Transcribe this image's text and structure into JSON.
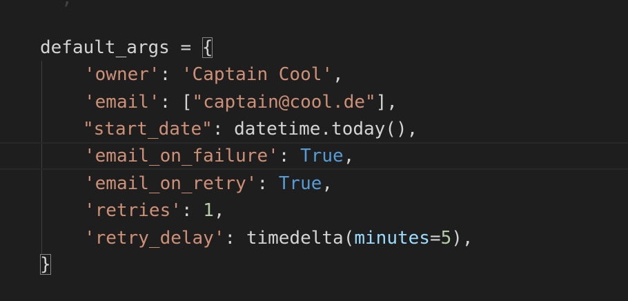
{
  "colors": {
    "background": "#1e1e1e",
    "string": "#ce9178",
    "keyword": "#569cd6",
    "number": "#b5cea8",
    "parameter": "#9cdcfe",
    "text": "#d4d4d4"
  },
  "code": {
    "partial_top": "  , ",
    "line_assign": {
      "name": "default_args",
      "op": " = ",
      "open": "{"
    },
    "line_owner": {
      "key": "'owner'",
      "sep": ": ",
      "value": "'Captain Cool'",
      "end": ","
    },
    "line_email": {
      "key": "'email'",
      "sep": ": ",
      "open": "[",
      "value": "\"captain@cool.de\"",
      "close": "],"
    },
    "line_start_date": {
      "key": "\"start_date\"",
      "sep": ": ",
      "value": "datetime.today()",
      "end": ","
    },
    "line_email_on_failure": {
      "key": "'email_on_failure'",
      "sep": ": ",
      "value": "True",
      "end": ","
    },
    "line_email_on_retry": {
      "key": "'email_on_retry'",
      "sep": ": ",
      "value": "True",
      "end": ","
    },
    "line_retries": {
      "key": "'retries'",
      "sep": ": ",
      "value": "1",
      "end": ","
    },
    "line_retry_delay": {
      "key": "'retry_delay'",
      "sep": ": ",
      "func": "timedelta(",
      "param": "minutes",
      "eq": "=",
      "num": "5",
      "end": "),"
    },
    "line_close": {
      "close": "}"
    }
  }
}
